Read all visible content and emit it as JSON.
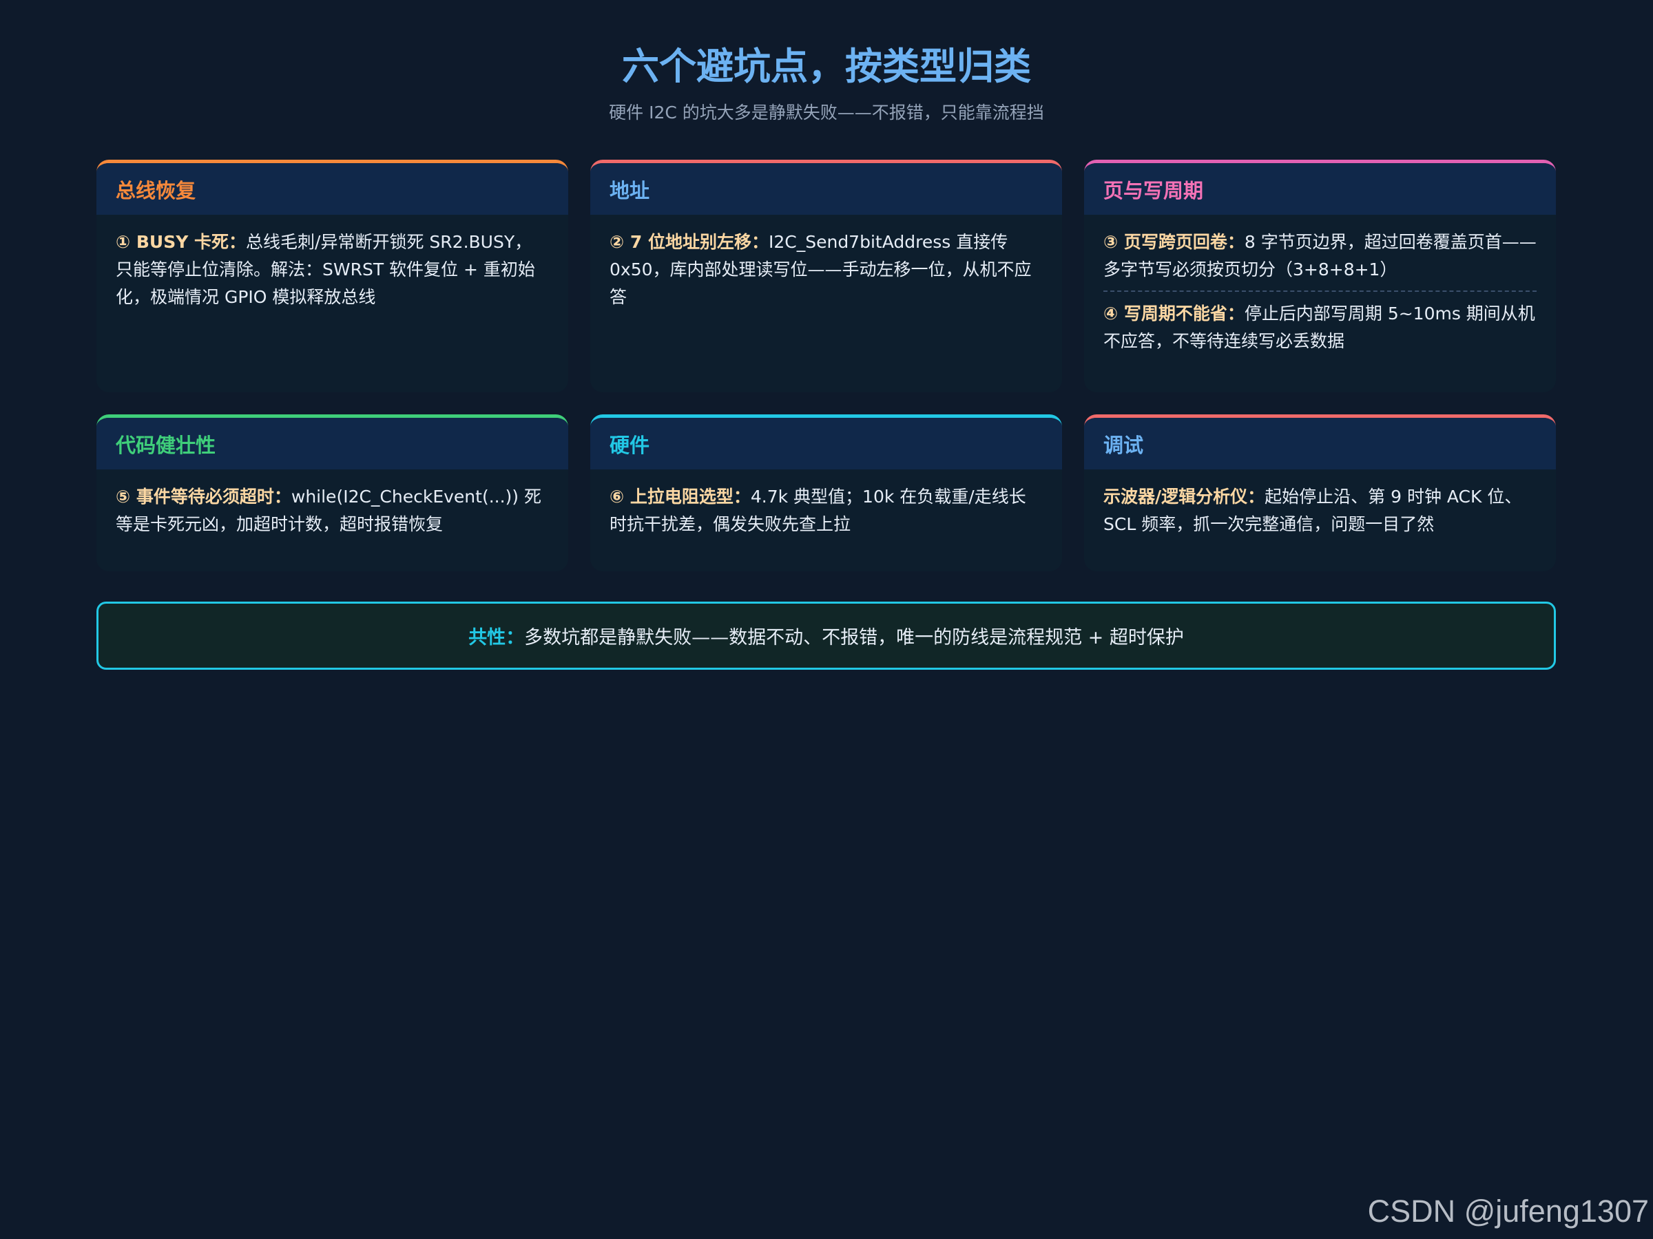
{
  "header": {
    "title": "六个避坑点，按类型归类",
    "subtitle": "硬件 I2C 的坑大多是静默失败——不报错，只能靠流程挡"
  },
  "cards": [
    {
      "title": "总线恢复",
      "accent": "#f6893b",
      "title_color": "#f6893b",
      "items": [
        {
          "label": "① BUSY 卡死：",
          "text": "总线毛刺/异常断开锁死 SR2.BUSY，只能等停止位清除。解法：SWRST 软件复位 + 重初始化，极端情况 GPIO 模拟释放总线"
        }
      ]
    },
    {
      "title": "地址",
      "accent": "#f06a6a",
      "title_color": "#6cb2f2",
      "items": [
        {
          "label": "② 7 位地址别左移：",
          "text": "I2C_Send7bitAddress 直接传 0x50，库内部处理读写位——手动左移一位，从机不应答"
        }
      ]
    },
    {
      "title": "页与写周期",
      "accent": "#e261b3",
      "title_color": "#f472b6",
      "items": [
        {
          "label": "③ 页写跨页回卷：",
          "text": "8 字节页边界，超过回卷覆盖页首——多字节写必须按页切分（3+8+8+1）"
        },
        {
          "label": "④ 写周期不能省：",
          "text": "停止后内部写周期 5~10ms 期间从机不应答，不等待连续写必丢数据"
        }
      ]
    },
    {
      "title": "代码健壮性",
      "accent": "#3fcf7a",
      "title_color": "#3fcf7a",
      "items": [
        {
          "label": "⑤ 事件等待必须超时：",
          "text": "while(I2C_CheckEvent(...)) 死等是卡死元凶，加超时计数，超时报错恢复"
        }
      ]
    },
    {
      "title": "硬件",
      "accent": "#22c8e5",
      "title_color": "#22c8e5",
      "items": [
        {
          "label": "⑥ 上拉电阻选型：",
          "text": "4.7k 典型值；10k 在负载重/走线长时抗干扰差，偶发失败先查上拉"
        }
      ]
    },
    {
      "title": "调试",
      "accent": "#f06a6a",
      "title_color": "#6cb2f2",
      "items": [
        {
          "label": "示波器/逻辑分析仪：",
          "text": "起始停止沿、第 9 时钟 ACK 位、SCL 频率，抓一次完整通信，问题一目了然"
        }
      ]
    }
  ],
  "summary": {
    "label": "共性：",
    "text": "多数坑都是静默失败——数据不动、不报错，唯一的防线是流程规范 + 超时保护",
    "accent": "#22c8e5"
  },
  "watermark": "CSDN @jufeng1307"
}
